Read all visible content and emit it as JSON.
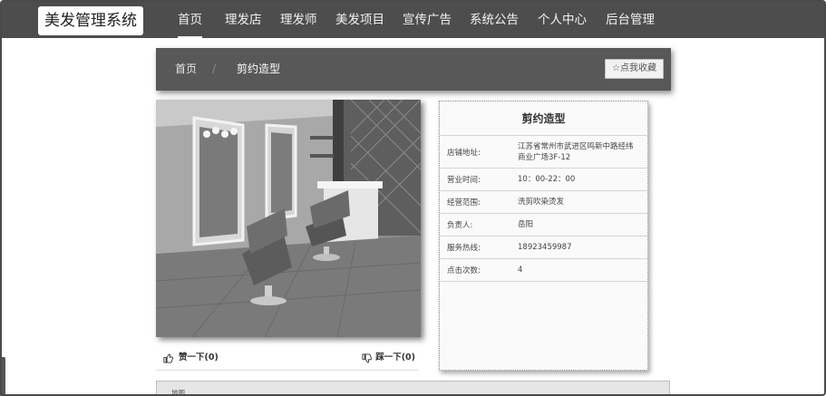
{
  "app": {
    "logo_text": "美发管理系统"
  },
  "nav": {
    "items": [
      {
        "label": "首页",
        "active": true
      },
      {
        "label": "理发店",
        "active": false
      },
      {
        "label": "理发师",
        "active": false
      },
      {
        "label": "美发项目",
        "active": false
      },
      {
        "label": "宣传广告",
        "active": false
      },
      {
        "label": "系统公告",
        "active": false
      },
      {
        "label": "个人中心",
        "active": false
      },
      {
        "label": "后台管理",
        "active": false
      }
    ]
  },
  "breadcrumb": {
    "home": "首页",
    "separator": "/",
    "current": "剪约造型",
    "favorite_label": "☆点我收藏"
  },
  "photo": {
    "subject": "salon interior"
  },
  "votes": {
    "up_label": "赞一下(0)",
    "down_label": "踩一下(0)"
  },
  "info": {
    "title": "剪约造型",
    "rows": [
      {
        "label": "店铺地址:",
        "value": "江苏省常州市武进区鸣新中路经纬商业广场3F-12"
      },
      {
        "label": "营业时间:",
        "value": "10：00-22：00"
      },
      {
        "label": "经营范围:",
        "value": "洗剪吹染烫发"
      },
      {
        "label": "负责人:",
        "value": "岳阳"
      },
      {
        "label": "服务热线:",
        "value": "18923459987"
      },
      {
        "label": "点击次数:",
        "value": "4"
      }
    ]
  },
  "map": {
    "label": "地图"
  },
  "colors": {
    "navbar": "#4d4d4d",
    "breadcrumb_bar": "#585858",
    "card_bg": "#fafafa"
  }
}
